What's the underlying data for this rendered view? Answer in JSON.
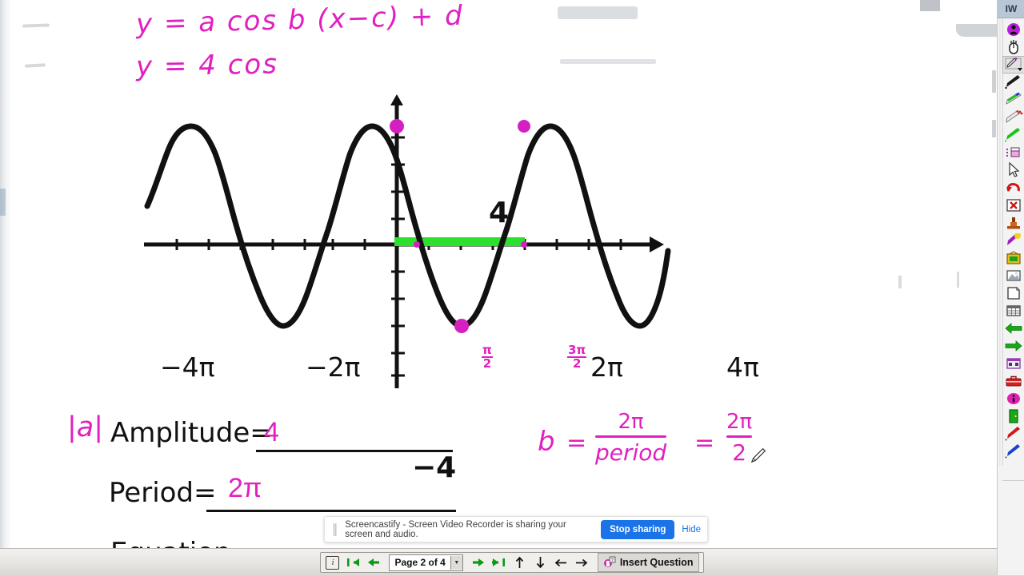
{
  "whiteboard": {
    "equations": [
      {
        "id": "formula-general",
        "text": "y = a cos b (x−c) + d"
      },
      {
        "id": "formula-applied",
        "text": "y = 4 cos"
      }
    ],
    "worksheet": {
      "abs_a": "|a|",
      "amplitude_label": "Amplitude=",
      "amplitude_value": "4",
      "period_label": "Period=",
      "period_value": "2π",
      "cut_line": "Equation"
    },
    "b_formula": {
      "variable": "b",
      "equals_1": "=",
      "frac1_num": "2π",
      "frac1_den": "period",
      "equals_2": "=",
      "frac2_num": "2π",
      "frac2_den": "2"
    }
  },
  "chart_data": {
    "type": "line",
    "title": "",
    "function": "y = 4 cos(x)",
    "xlabel": "",
    "ylabel": "",
    "amplitude": 4,
    "period": "2π",
    "xlim": [
      -4.6,
      4.6
    ],
    "ylim": [
      -5,
      5
    ],
    "x_unit": "π",
    "grid": false,
    "legend": "none",
    "x_tick_labels": [
      "−4π",
      "−2π",
      "2π",
      "4π"
    ],
    "x_tick_values": [
      -4,
      -2,
      2,
      4
    ],
    "y_tick_labels": [
      "4",
      "−4"
    ],
    "y_tick_values": [
      4,
      -4
    ],
    "annotations": [
      {
        "name": "pi-over-2",
        "text_top": "π",
        "text_bottom": "2",
        "x": 0.5,
        "y": 0,
        "color": "#e020c0"
      },
      {
        "name": "three-pi-over-2",
        "text_top": "3π",
        "text_bottom": "2",
        "x": 1.5,
        "y": 0,
        "color": "#e020c0"
      }
    ],
    "marked_points": [
      {
        "name": "maximum-at-zero",
        "x": 0,
        "y": 4
      },
      {
        "name": "minimum-at-pi",
        "x": 1,
        "y": -4
      },
      {
        "name": "maximum-at-two-pi",
        "x": 2,
        "y": 4
      }
    ],
    "highlight_segment": {
      "name": "period-highlight",
      "from_x": 0,
      "to_x": 1.5,
      "y": 0,
      "color": "#2ee02e"
    },
    "series": [
      {
        "name": "y = 4 cos(x)",
        "color": "#111111",
        "x": [
          -4.6,
          -4,
          -3.5,
          -3,
          -2.5,
          -2,
          -1.5,
          -1,
          -0.5,
          0,
          0.5,
          1,
          1.5,
          2,
          2.5,
          3,
          3.5,
          4,
          4.3
        ],
        "values": [
          2.4,
          4,
          0,
          -4,
          0,
          4,
          0,
          -4,
          0,
          4,
          0,
          -4,
          0,
          4,
          0,
          -4,
          0,
          4,
          2.4
        ]
      }
    ]
  },
  "screencast_bar": {
    "pause_icon": "pause-icon",
    "message": "Screencastify - Screen Video Recorder is sharing your screen and audio.",
    "stop_label": "Stop sharing",
    "hide_label": "Hide"
  },
  "navbar": {
    "info_icon": "info-icon",
    "first_page_icon": "first-page-icon",
    "prev_page_icon": "previous-page-icon",
    "page_selector": "Page 2 of 4",
    "page_selector_caret": "chevron-down-icon",
    "next_page_icon": "next-page-icon",
    "last_page_icon": "last-page-icon",
    "scroll_up_icon": "arrow-up-icon",
    "scroll_down_icon": "arrow-down-icon",
    "scroll_left_icon": "arrow-left-icon",
    "scroll_right_icon": "arrow-right-icon",
    "insert_question_icon": "insert-question-icon",
    "insert_question_label": "Insert Question"
  },
  "toolbar": {
    "title": "IW",
    "items": [
      "user-icon",
      "mouse-icon",
      "pen-dropdown-icon",
      "marker-black-icon",
      "highlighter-green-icon",
      "glitter-pen-icon",
      "pen-green-icon",
      "eraser-icon",
      "cursor-arrow-icon",
      "undo-icon",
      "delete-icon",
      "stamp-icon",
      "spotlight-icon",
      "picture-frame-icon",
      "image-icon",
      "blank-page-icon",
      "grid-icon",
      "arrow-left-green-icon",
      "arrow-right-green-icon",
      "pattern-icon",
      "toolbox-icon",
      "info-circle-icon",
      "exit-door-icon",
      "pen-red-icon",
      "pen-blue-icon"
    ]
  },
  "colors": {
    "ink": "#e020c0",
    "curve": "#111111",
    "highlight": "#2ee02e",
    "accent_blue": "#1a73e8",
    "nav_green": "#0a9a18"
  }
}
